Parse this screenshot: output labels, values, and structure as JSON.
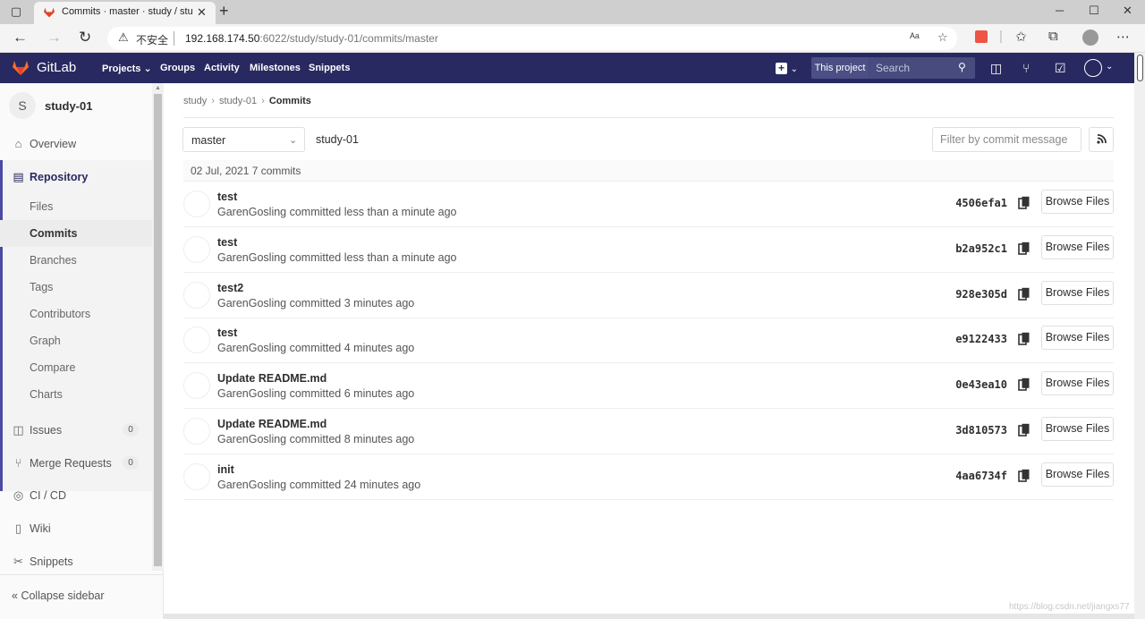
{
  "browser": {
    "tab_title": "Commits · master · study / study",
    "insecure_label": "不安全",
    "url_host": "192.168.174.50",
    "url_path": ":6022/study/study-01/commits/master"
  },
  "header": {
    "brand": "GitLab",
    "nav": [
      "Projects",
      "Groups",
      "Activity",
      "Milestones",
      "Snippets"
    ],
    "scope_label": "This project",
    "search_placeholder": "Search"
  },
  "sidebar": {
    "project_initial": "S",
    "project_name": "study-01",
    "overview": "Overview",
    "repository": "Repository",
    "repo_items": [
      "Files",
      "Commits",
      "Branches",
      "Tags",
      "Contributors",
      "Graph",
      "Compare",
      "Charts"
    ],
    "active_repo_item": "Commits",
    "issues": {
      "label": "Issues",
      "count": "0"
    },
    "merge_requests": {
      "label": "Merge Requests",
      "count": "0"
    },
    "cicd": "CI / CD",
    "wiki": "Wiki",
    "snippets": "Snippets",
    "collapse": "Collapse sidebar"
  },
  "breadcrumb": [
    "study",
    "study-01",
    "Commits"
  ],
  "toolbar": {
    "branch": "master",
    "project_path": "study-01",
    "filter_placeholder": "Filter by commit message"
  },
  "day_header": "02 Jul, 2021 7 commits",
  "commits": [
    {
      "title": "test",
      "author": "GarenGosling",
      "time": "committed less than a minute ago",
      "sha": "4506efa1",
      "browse": "Browse Files"
    },
    {
      "title": "test",
      "author": "GarenGosling",
      "time": "committed less than a minute ago",
      "sha": "b2a952c1",
      "browse": "Browse Files"
    },
    {
      "title": "test2",
      "author": "GarenGosling",
      "time": "committed 3 minutes ago",
      "sha": "928e305d",
      "browse": "Browse Files"
    },
    {
      "title": "test",
      "author": "GarenGosling",
      "time": "committed 4 minutes ago",
      "sha": "e9122433",
      "browse": "Browse Files"
    },
    {
      "title": "Update README.md",
      "author": "GarenGosling",
      "time": "committed 6 minutes ago",
      "sha": "0e43ea10",
      "browse": "Browse Files"
    },
    {
      "title": "Update README.md",
      "author": "GarenGosling",
      "time": "committed 8 minutes ago",
      "sha": "3d810573",
      "browse": "Browse Files"
    },
    {
      "title": "init",
      "author": "GarenGosling",
      "time": "committed 24 minutes ago",
      "sha": "4aa6734f",
      "browse": "Browse Files"
    }
  ],
  "watermark": "https://blog.csdn.net/jiangxs77",
  "colors": {
    "header_bg": "#292961",
    "accent": "#4b4ba3",
    "gitlab_orange": "#e24329"
  }
}
